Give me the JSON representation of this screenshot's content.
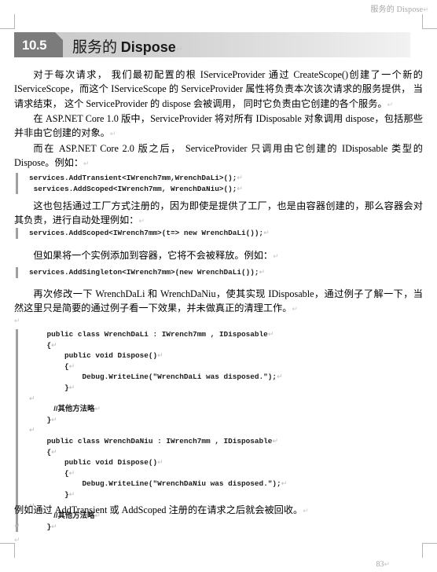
{
  "document": {
    "running_header": "服务的 Dispose",
    "pilcrow": "↵",
    "page_number": "83"
  },
  "section": {
    "number": "10.5",
    "title_cn": "服务的 ",
    "title_en": "Dispose"
  },
  "paragraphs": {
    "p1": "对于每次请求， 我们最初配置的根 IServiceProvider 通过 CreateScope()创建了一个新的 IServiceScope，而这个 IServiceScope 的 ServiceProvider 属性将负责本次该次请求的服务提供， 当请求结束， 这个 ServiceProvider 的 dispose 会被调用， 同时它负责由它创建的各个服务。",
    "p2": "在 ASP.NET Core 1.0 版中，ServiceProvider 将对所有 IDisposable 对象调用 dispose，包括那些并非由它创建的对象。",
    "p3": "而在 ASP.NET Core 2.0 版之后， ServiceProvider 只调用由它创建的 IDisposable 类型的 Dispose。例如：",
    "p4": "这也包括通过工厂方式注册的，因为即使是提供了工厂，也是由容器创建的，那么容器会对其负责，进行自动处理例如：",
    "p5": "但如果将一个实例添加到容器，它将不会被释放。例如：",
    "p6": "再次修改一下 WrenchDaLi 和 WrenchDaNiu，使其实现 IDisposable，通过例子了解一下，当然这里只是简要的通过例子看一下效果，并未做真正的清理工作。",
    "p7": "例如通过 AddTransient 或 AddScoped 注册的在请求之后就会被回收。"
  },
  "code_blocks": {
    "block1": [
      "services.AddTransient<IWrench7mm,WrenchDaLi>();",
      " services.AddScoped<IWrench7mm, WrenchDaNiu>();"
    ],
    "block2": [
      "services.AddScoped<IWrench7mm>(t=> new WrenchDaLi());"
    ],
    "block3": [
      "services.AddSingleton<IWrench7mm>(new WrenchDaLi());"
    ],
    "block4": [
      "    public class WrenchDaLi : IWrench7mm , IDisposable",
      "    {",
      "        public void Dispose()",
      "        {",
      "            Debug.WriteLine(\"WrenchDaLi was disposed.\");",
      "        }",
      "",
      "            //其他方法略",
      "    }",
      "",
      "    public class WrenchDaNiu : IWrench7mm , IDisposable",
      "    {",
      "        public void Dispose()",
      "        {",
      "            Debug.WriteLine(\"WrenchDaNiu was disposed.\");",
      "        }",
      "",
      "            //其他方法略",
      "    }"
    ]
  },
  "colors": {
    "section_tab": "#7b7b7b",
    "header_text": "#a6a6a6",
    "code_rule": "#a0a0a0"
  }
}
